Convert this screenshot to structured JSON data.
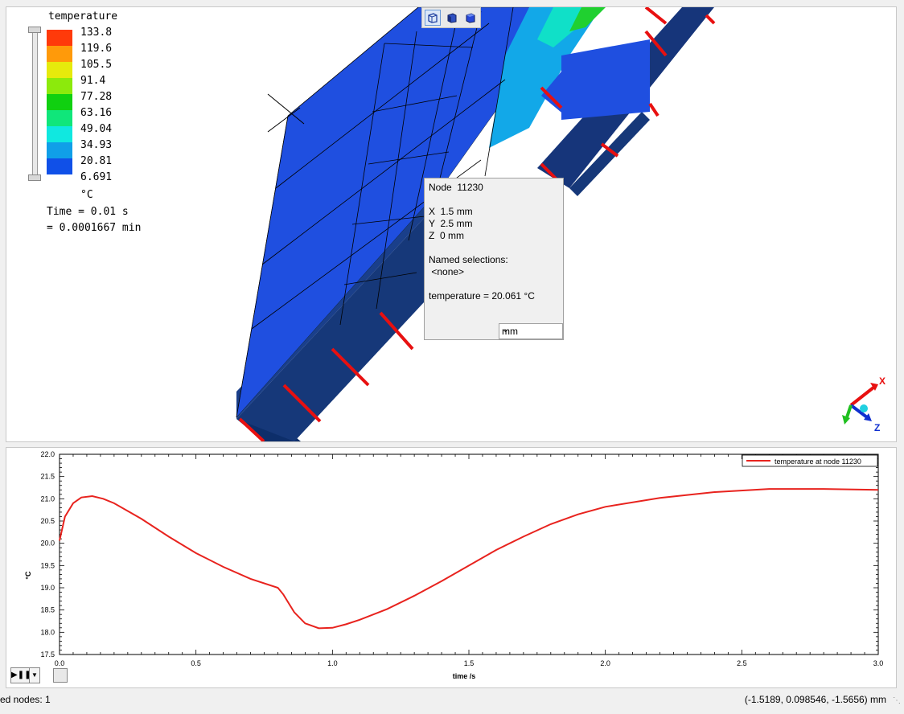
{
  "legend": {
    "title": "temperature",
    "colors": [
      "#ff3a0a",
      "#ff9a0a",
      "#e6ea0c",
      "#8cea0c",
      "#10d010",
      "#10e67a",
      "#10e8e0",
      "#109fe8",
      "#1050e8"
    ],
    "values": [
      "133.8",
      "119.6",
      "105.5",
      "91.4",
      "77.28",
      "63.16",
      "49.04",
      "34.93",
      "20.81",
      "6.691"
    ],
    "unit": "°C",
    "time_line1": "Time = 0.01 s",
    "time_line2": "= 0.0001667 min"
  },
  "toolbar": {
    "icons": [
      "iso-view-icon",
      "front-view-icon",
      "shaded-view-icon"
    ]
  },
  "probe": {
    "node": "Node  11230",
    "x": "X  1.5 mm",
    "y": "Y  2.5 mm",
    "z": "Z  0 mm",
    "named_label": "Named selections:",
    "named_value": " <none>",
    "temperature": "temperature = 20.061 °C",
    "unit_value": "mm"
  },
  "triad": {
    "x": "X",
    "z": "Z"
  },
  "chart_data": {
    "type": "line",
    "xlabel": "time /s",
    "ylabel": "°C",
    "xlim": [
      0.0,
      3.0
    ],
    "ylim": [
      17.5,
      22.0
    ],
    "x_ticks": [
      "0.0",
      "0.5",
      "1.0",
      "1.5",
      "2.0",
      "2.5",
      "3.0"
    ],
    "y_ticks": [
      "17.5",
      "18.0",
      "18.5",
      "19.0",
      "19.5",
      "20.0",
      "20.5",
      "21.0",
      "21.5",
      "22.0"
    ],
    "legend": "temperature at node 11230",
    "color": "#e8231e",
    "series": [
      {
        "name": "temperature at node 11230",
        "x": [
          0.0,
          0.02,
          0.05,
          0.08,
          0.12,
          0.16,
          0.2,
          0.3,
          0.4,
          0.5,
          0.6,
          0.7,
          0.8,
          0.82,
          0.86,
          0.9,
          0.95,
          1.0,
          1.05,
          1.1,
          1.2,
          1.3,
          1.4,
          1.5,
          1.6,
          1.7,
          1.8,
          1.9,
          2.0,
          2.2,
          2.4,
          2.6,
          2.8,
          3.0
        ],
        "y": [
          20.06,
          20.6,
          20.9,
          21.03,
          21.06,
          21.0,
          20.9,
          20.55,
          20.15,
          19.78,
          19.47,
          19.2,
          19.0,
          18.85,
          18.45,
          18.2,
          18.09,
          18.1,
          18.18,
          18.28,
          18.52,
          18.82,
          19.15,
          19.5,
          19.85,
          20.15,
          20.43,
          20.65,
          20.82,
          21.02,
          21.15,
          21.22,
          21.22,
          21.2
        ]
      }
    ]
  },
  "status": {
    "left": "ed nodes: 1",
    "right": "(-1.5189, 0.098546, -1.5656) mm"
  }
}
